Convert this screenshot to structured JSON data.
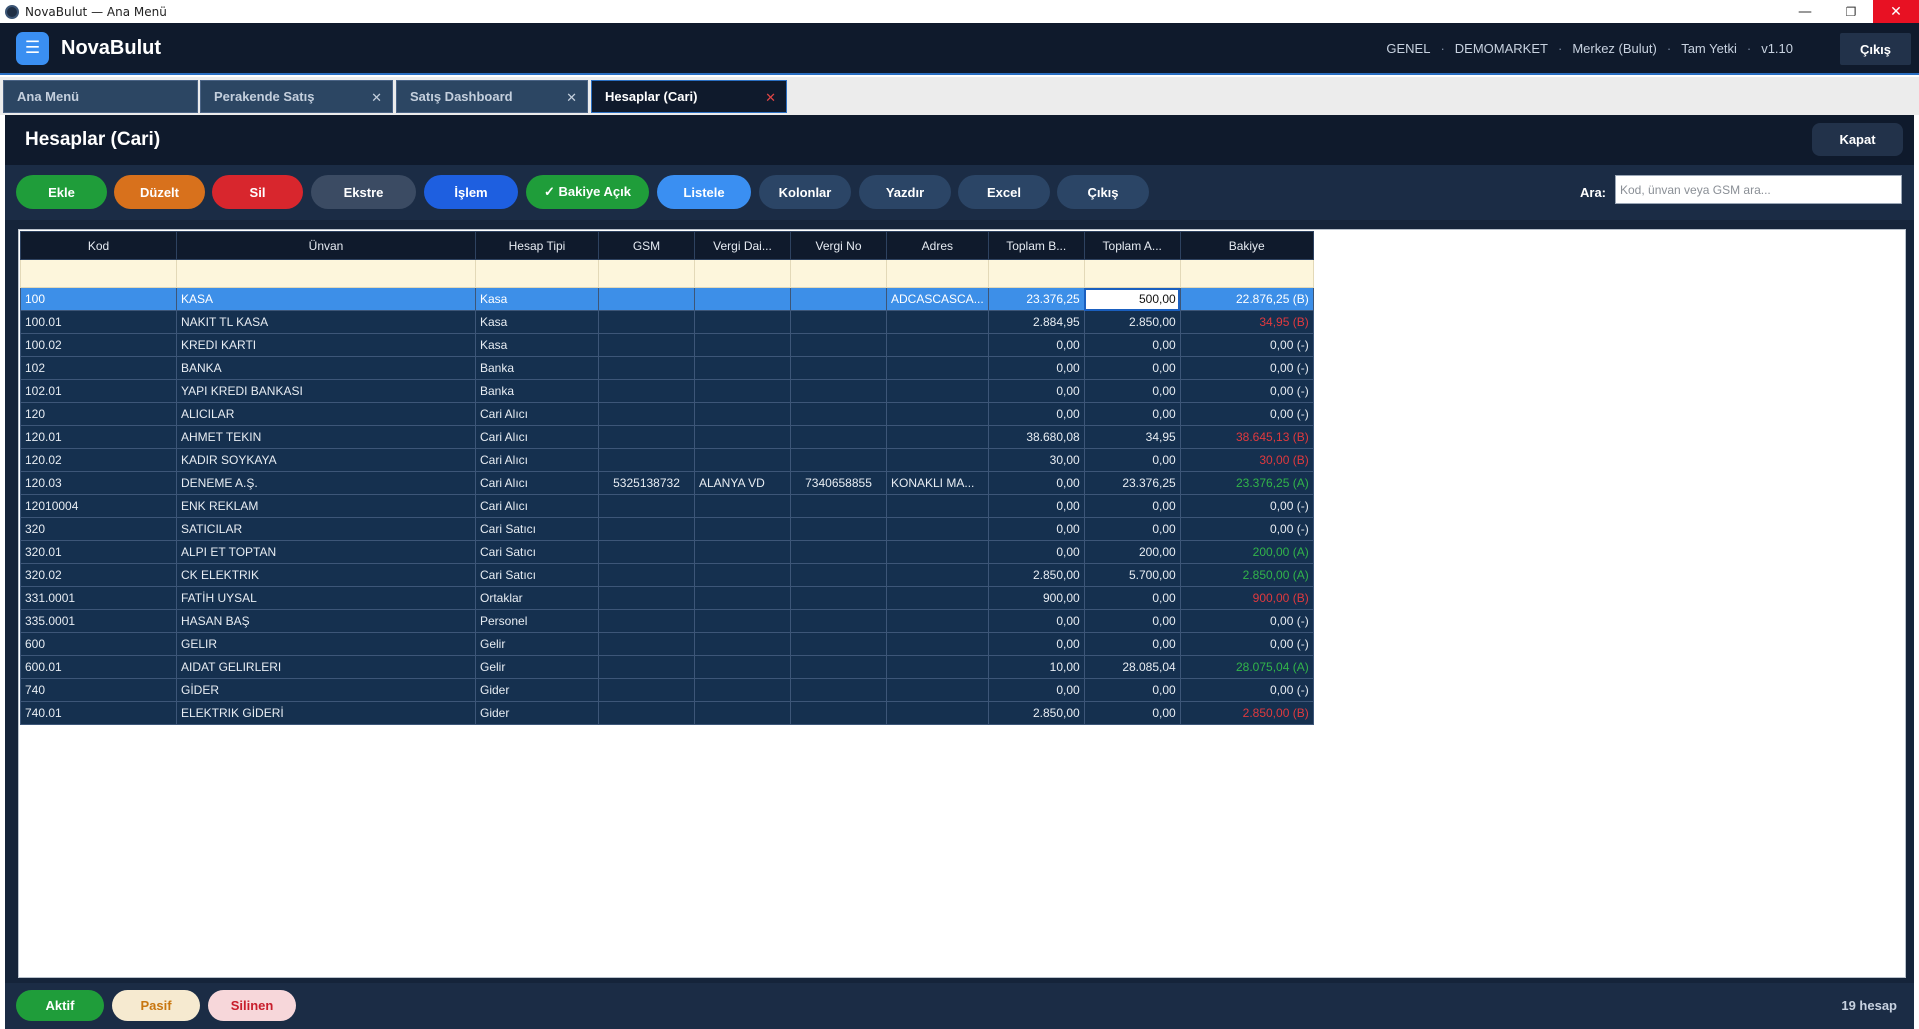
{
  "window": {
    "title": "NovaBulut — Ana Menü"
  },
  "app": {
    "brand": "NovaBulut",
    "meta": [
      "GENEL",
      "DEMOMARKET",
      "Merkez (Bulut)",
      "Tam Yetki",
      "v1.10"
    ],
    "exit_label": "Çıkış"
  },
  "tabs": [
    {
      "label": "Ana Menü",
      "closable": false
    },
    {
      "label": "Perakende Satış",
      "closable": true
    },
    {
      "label": "Satış Dashboard",
      "closable": true
    },
    {
      "label": "Hesaplar (Cari)",
      "closable": true,
      "active": true
    }
  ],
  "panel": {
    "title": "Hesaplar (Cari)",
    "close_label": "Kapat"
  },
  "toolbar": {
    "buttons": [
      {
        "label": "Ekle",
        "color": "#1f9d3a"
      },
      {
        "label": "Düzelt",
        "color": "#d8711c"
      },
      {
        "label": "Sil",
        "color": "#d8262d"
      },
      {
        "label": "Ekstre",
        "color": "#3b4b63"
      },
      {
        "label": "İşlem",
        "color": "#1e5fe0"
      },
      {
        "label": "✓ Bakiye Açık",
        "color": "#1f9d3a"
      },
      {
        "label": "Listele",
        "color": "#3a8ff2"
      },
      {
        "label": "Kolonlar",
        "color": "#2b4566"
      },
      {
        "label": "Yazdır",
        "color": "#2b4566"
      },
      {
        "label": "Excel",
        "color": "#2b4566"
      },
      {
        "label": "Çıkış",
        "color": "#2b4566"
      }
    ],
    "search_label": "Ara:",
    "search_placeholder": "Kod, ünvan veya GSM ara..."
  },
  "grid": {
    "columns": [
      "Kod",
      "Ünvan",
      "Hesap Tipi",
      "GSM",
      "Vergi Dai...",
      "Vergi No",
      "Adres",
      "Toplam B...",
      "Toplam A...",
      "Bakiye"
    ],
    "rows": [
      {
        "kod": "100",
        "unvan": "KASA",
        "tip": "Kasa",
        "gsm": "",
        "vd": "",
        "vno": "",
        "adres": "ADCASCASCA...",
        "borc": "23.376,25",
        "alacak": "500,00",
        "bakiye": "22.876,25 (B)",
        "status": "neutral",
        "selected": true
      },
      {
        "kod": "100.01",
        "unvan": "NAKIT TL KASA",
        "tip": "Kasa",
        "gsm": "",
        "vd": "",
        "vno": "",
        "adres": "",
        "borc": "2.884,95",
        "alacak": "2.850,00",
        "bakiye": "34,95 (B)",
        "status": "borc"
      },
      {
        "kod": "100.02",
        "unvan": "KREDI KARTI",
        "tip": "Kasa",
        "gsm": "",
        "vd": "",
        "vno": "",
        "adres": "",
        "borc": "0,00",
        "alacak": "0,00",
        "bakiye": "0,00 (-)",
        "status": "neutral"
      },
      {
        "kod": "102",
        "unvan": "BANKA",
        "tip": "Banka",
        "gsm": "",
        "vd": "",
        "vno": "",
        "adres": "",
        "borc": "0,00",
        "alacak": "0,00",
        "bakiye": "0,00 (-)",
        "status": "neutral"
      },
      {
        "kod": "102.01",
        "unvan": "YAPI KREDI BANKASI",
        "tip": "Banka",
        "gsm": "",
        "vd": "",
        "vno": "",
        "adres": "",
        "borc": "0,00",
        "alacak": "0,00",
        "bakiye": "0,00 (-)",
        "status": "neutral"
      },
      {
        "kod": "120",
        "unvan": "ALICILAR",
        "tip": "Cari Alıcı",
        "gsm": "",
        "vd": "",
        "vno": "",
        "adres": "",
        "borc": "0,00",
        "alacak": "0,00",
        "bakiye": "0,00 (-)",
        "status": "neutral"
      },
      {
        "kod": "120.01",
        "unvan": "AHMET TEKIN",
        "tip": "Cari Alıcı",
        "gsm": "",
        "vd": "",
        "vno": "",
        "adres": "",
        "borc": "38.680,08",
        "alacak": "34,95",
        "bakiye": "38.645,13 (B)",
        "status": "borc"
      },
      {
        "kod": "120.02",
        "unvan": "KADIR SOYKAYA",
        "tip": "Cari Alıcı",
        "gsm": "",
        "vd": "",
        "vno": "",
        "adres": "",
        "borc": "30,00",
        "alacak": "0,00",
        "bakiye": "30,00 (B)",
        "status": "borc"
      },
      {
        "kod": "120.03",
        "unvan": "DENEME A.Ş.",
        "tip": "Cari Alıcı",
        "gsm": "5325138732",
        "vd": "ALANYA VD",
        "vno": "7340658855",
        "adres": "KONAKLI MA...",
        "borc": "0,00",
        "alacak": "23.376,25",
        "bakiye": "23.376,25 (A)",
        "status": "alacak"
      },
      {
        "kod": "12010004",
        "unvan": "ENK REKLAM",
        "tip": "Cari Alıcı",
        "gsm": "",
        "vd": "",
        "vno": "",
        "adres": "",
        "borc": "0,00",
        "alacak": "0,00",
        "bakiye": "0,00 (-)",
        "status": "neutral"
      },
      {
        "kod": "320",
        "unvan": "SATICILAR",
        "tip": "Cari Satıcı",
        "gsm": "",
        "vd": "",
        "vno": "",
        "adres": "",
        "borc": "0,00",
        "alacak": "0,00",
        "bakiye": "0,00 (-)",
        "status": "neutral"
      },
      {
        "kod": "320.01",
        "unvan": "ALPI ET TOPTAN",
        "tip": "Cari Satıcı",
        "gsm": "",
        "vd": "",
        "vno": "",
        "adres": "",
        "borc": "0,00",
        "alacak": "200,00",
        "bakiye": "200,00 (A)",
        "status": "alacak"
      },
      {
        "kod": "320.02",
        "unvan": "CK ELEKTRIK",
        "tip": "Cari Satıcı",
        "gsm": "",
        "vd": "",
        "vno": "",
        "adres": "",
        "borc": "2.850,00",
        "alacak": "5.700,00",
        "bakiye": "2.850,00 (A)",
        "status": "alacak"
      },
      {
        "kod": "331.0001",
        "unvan": "FATİH UYSAL",
        "tip": "Ortaklar",
        "gsm": "",
        "vd": "",
        "vno": "",
        "adres": "",
        "borc": "900,00",
        "alacak": "0,00",
        "bakiye": "900,00 (B)",
        "status": "borc"
      },
      {
        "kod": "335.0001",
        "unvan": "HASAN BAŞ",
        "tip": "Personel",
        "gsm": "",
        "vd": "",
        "vno": "",
        "adres": "",
        "borc": "0,00",
        "alacak": "0,00",
        "bakiye": "0,00 (-)",
        "status": "neutral"
      },
      {
        "kod": "600",
        "unvan": "GELIR",
        "tip": "Gelir",
        "gsm": "",
        "vd": "",
        "vno": "",
        "adres": "",
        "borc": "0,00",
        "alacak": "0,00",
        "bakiye": "0,00 (-)",
        "status": "neutral"
      },
      {
        "kod": "600.01",
        "unvan": "AIDAT GELIRLERI",
        "tip": "Gelir",
        "gsm": "",
        "vd": "",
        "vno": "",
        "adres": "",
        "borc": "10,00",
        "alacak": "28.085,04",
        "bakiye": "28.075,04 (A)",
        "status": "alacak"
      },
      {
        "kod": "740",
        "unvan": "GİDER",
        "tip": "Gider",
        "gsm": "",
        "vd": "",
        "vno": "",
        "adres": "",
        "borc": "0,00",
        "alacak": "0,00",
        "bakiye": "0,00 (-)",
        "status": "neutral"
      },
      {
        "kod": "740.01",
        "unvan": "ELEKTRIK GİDERİ",
        "tip": "Gider",
        "gsm": "",
        "vd": "",
        "vno": "",
        "adres": "",
        "borc": "2.850,00",
        "alacak": "0,00",
        "bakiye": "2.850,00 (B)",
        "status": "borc"
      }
    ]
  },
  "status_colors": {
    "borc": "#e0393e",
    "alacak": "#32b44a",
    "neutral": "#e8edf3"
  },
  "footer": {
    "filters": [
      {
        "label": "Aktif",
        "bg": "#1f9d3a",
        "fg": "#ffffff"
      },
      {
        "label": "Pasif",
        "bg": "#f6ead0",
        "fg": "#c8760f"
      },
      {
        "label": "Silinen",
        "bg": "#f7d7da",
        "fg": "#c81d2b"
      }
    ],
    "count_label": "19 hesap"
  }
}
